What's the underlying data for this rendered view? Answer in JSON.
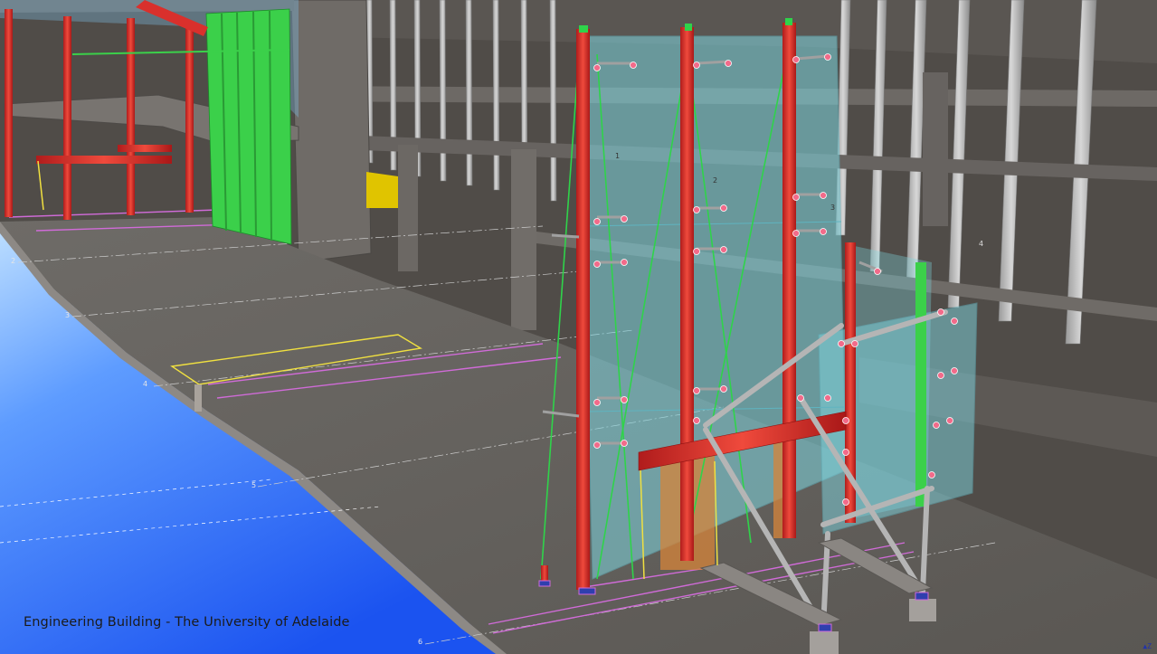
{
  "caption": "Engineering Building - The University of Adelaide",
  "grid_labels": [
    "2",
    "3",
    "4",
    "5",
    "6"
  ],
  "panel_labels": [
    "1",
    "2",
    "3",
    "4"
  ],
  "axis_indicator": "Z",
  "colors": {
    "sky": "#4a86ff",
    "slab": "#6b6763",
    "steel_column": "#d9302c",
    "glass_panel": "#7fd6e0",
    "bracing": "#a9a9a9",
    "mullion": "#2fd34a",
    "gridline_magenta": "#d06bd8",
    "outline_yellow": "#f0e040",
    "spandrel_orange": "#d6843a"
  }
}
